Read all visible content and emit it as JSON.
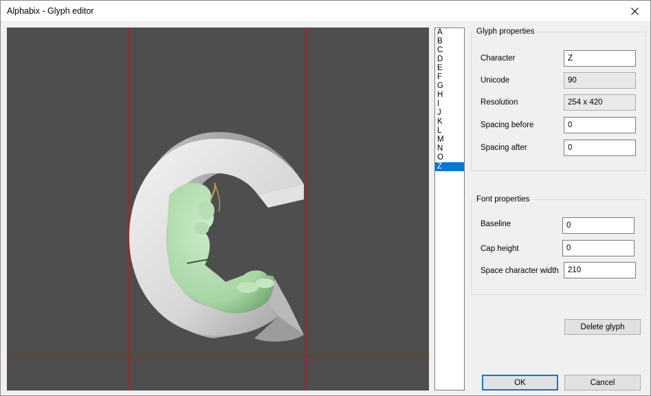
{
  "window": {
    "title": "Alphabix - Glyph editor"
  },
  "glyph_list": {
    "items": [
      "A",
      "B",
      "C",
      "D",
      "E",
      "F",
      "G",
      "H",
      "I",
      "J",
      "K",
      "L",
      "M",
      "N",
      "O",
      "Z"
    ],
    "selected_index": 15
  },
  "glyph_properties": {
    "group_title": "Glyph properties",
    "character_label": "Character",
    "character_value": "Z",
    "unicode_label": "Unicode",
    "unicode_value": "90",
    "resolution_label": "Resolution",
    "resolution_value": "254 x 420",
    "spacing_before_label": "Spacing before",
    "spacing_before_value": "0",
    "spacing_after_label": "Spacing after",
    "spacing_after_value": "0"
  },
  "font_properties": {
    "group_title": "Font properties",
    "baseline_label": "Baseline",
    "baseline_value": "0",
    "cap_height_label": "Cap height",
    "cap_height_value": "0",
    "space_width_label": "Space character width",
    "space_width_value": "210"
  },
  "buttons": {
    "delete_glyph": "Delete glyph",
    "ok": "OK",
    "cancel": "Cancel"
  },
  "colors": {
    "canvas_bg": "#4e4e4e",
    "guide_line": "#cc1111",
    "selection": "#0078d7"
  }
}
